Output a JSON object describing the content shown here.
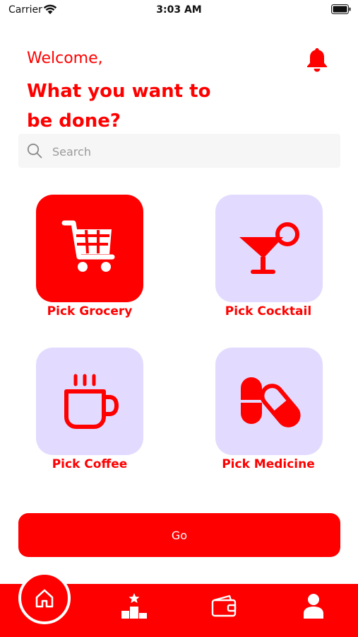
{
  "status_bar": {
    "carrier": "Carrier",
    "time": "3:03 AM"
  },
  "header": {
    "welcome": "Welcome,",
    "title": "What you want to be done?",
    "notification_icon": "bell-icon"
  },
  "search": {
    "placeholder": "Search",
    "value": ""
  },
  "services": [
    {
      "label": "Pick Grocery",
      "icon": "shopping-cart-icon",
      "selected": true
    },
    {
      "label": "Pick Cocktail",
      "icon": "cocktail-icon",
      "selected": false
    },
    {
      "label": "Pick Coffee",
      "icon": "coffee-cup-icon",
      "selected": false
    },
    {
      "label": "Pick Medicine",
      "icon": "pills-icon",
      "selected": false
    }
  ],
  "go_button": {
    "label": "Go"
  },
  "bottom_nav": {
    "items": [
      {
        "icon": "home-icon",
        "active": true
      },
      {
        "icon": "leaderboard-icon",
        "active": false
      },
      {
        "icon": "wallet-icon",
        "active": false
      },
      {
        "icon": "profile-icon",
        "active": false
      }
    ]
  },
  "colors": {
    "accent": "#ff0000",
    "tile_inactive": "#e2dbff",
    "search_background": "#f6f6f6"
  }
}
